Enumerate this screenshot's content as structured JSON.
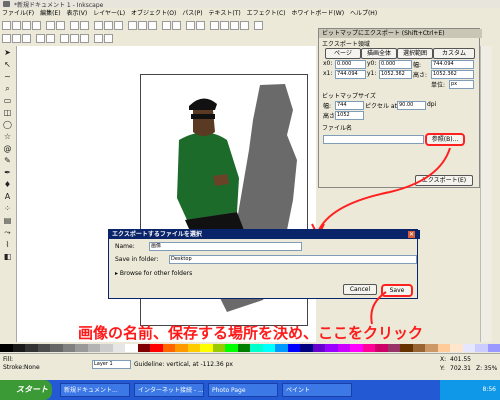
{
  "window": {
    "title": "*新規ドキュメント 1 - Inkscape"
  },
  "menu": [
    "ファイル(F)",
    "編集(E)",
    "表示(V)",
    "レイヤー(L)",
    "オブジェクト(O)",
    "パス(P)",
    "テキスト(T)",
    "エフェクト(C)",
    "ホワイトボード(W)",
    "ヘルプ(H)"
  ],
  "export_panel": {
    "title": "ビットマップにエクスポート (Shift+Ctrl+E)",
    "section_area": "エクスポート領域",
    "tabs": [
      "ページ",
      "描画全体",
      "選択範囲",
      "カスタム"
    ],
    "x0_label": "x0:",
    "x0": "0.000",
    "y0_label": "y0:",
    "y0": "0.000",
    "x1_label": "x1:",
    "x1": "744.094",
    "y1_label": "y1:",
    "y1": "1052.362",
    "width_label": "幅:",
    "width": "744.094",
    "height_label": "高さ:",
    "height": "1052.362",
    "units_label": "単位:",
    "units": "px",
    "section_bitmap": "ビットマップサイズ",
    "bw_label": "幅:",
    "bw": "744",
    "pixel_at": "ピクセル at",
    "dpi": "90.00",
    "dpi_unit": "dpi",
    "bh_label": "高さ:",
    "bh": "1052",
    "section_filename": "ファイル名",
    "browse_button": "参照(B)...",
    "export_button": "エクスポート(E)"
  },
  "save_dialog": {
    "title": "エクスポートするファイルを選択",
    "name_label": "Name:",
    "name_value": "画像",
    "folder_label": "Save in folder:",
    "folder_value": "Desktop",
    "browse_other": "Browse for other folders",
    "cancel_button": "Cancel",
    "save_button": "Save"
  },
  "callout": "画像の名前、保存する場所を決め、ここをクリック",
  "status": {
    "fill_label": "Fill:",
    "stroke_label": "Stroke:",
    "stroke_value": "None",
    "layer_value": "Layer 1",
    "message": "Guideline: vertical, at -112.36 px",
    "x_label": "X:",
    "x_value": "401.55",
    "y_label": "Y:",
    "y_value": "702.31",
    "zoom_label": "Z:",
    "zoom_value": "35%"
  },
  "taskbar": {
    "start": "スタート",
    "tasks": [
      "新規ドキュメント...",
      "インターネット接続 - ...",
      "Photo Page",
      "ペイント"
    ],
    "clock": "8:56"
  },
  "palette": [
    "#000000",
    "#1a1a1a",
    "#333333",
    "#4d4d4d",
    "#666666",
    "#808080",
    "#999999",
    "#b3b3b3",
    "#cccccc",
    "#e6e6e6",
    "#ffffff",
    "#800000",
    "#ff0000",
    "#ff6600",
    "#ff9900",
    "#ffcc00",
    "#ffff00",
    "#99cc00",
    "#00ff00",
    "#008000",
    "#00ffcc",
    "#00ffff",
    "#0099ff",
    "#0000ff",
    "#000080",
    "#6600cc",
    "#9900ff",
    "#cc00ff",
    "#ff00ff",
    "#ff0099",
    "#cc0066",
    "#993366",
    "#663300",
    "#996633",
    "#cc9966",
    "#ffcc99",
    "#ffe6cc",
    "#e6e6ff",
    "#ccccff",
    "#9999ff"
  ]
}
